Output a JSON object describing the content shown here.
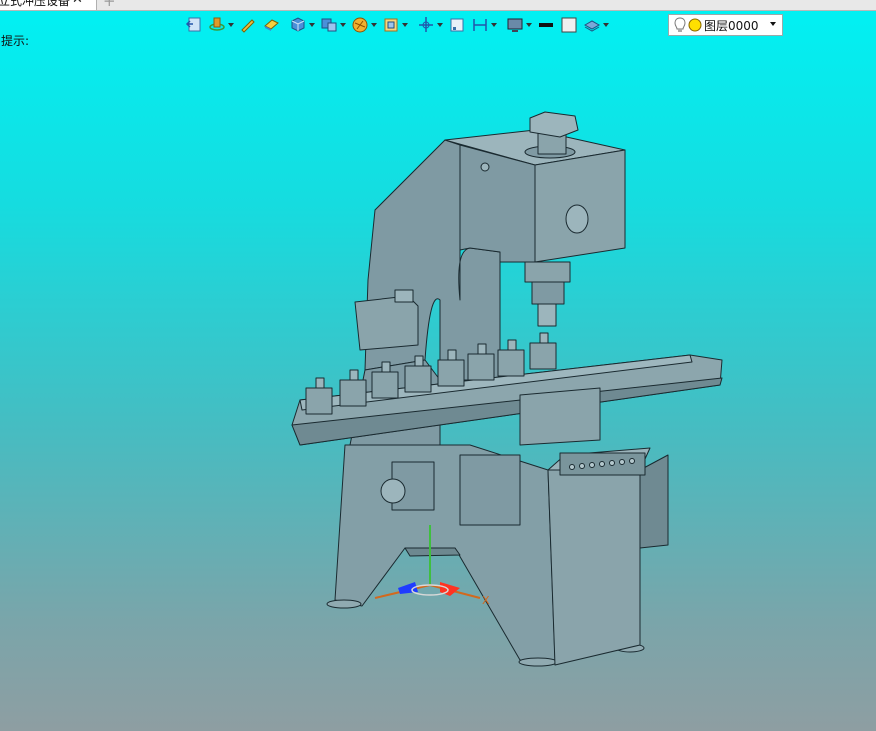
{
  "tab": {
    "title": "立式冲压设备",
    "close_glyph": "✕",
    "add_glyph": "+"
  },
  "hint": "提示:",
  "layer": {
    "value": "图层0000"
  },
  "colors": {
    "bg_top": "#00f2f4",
    "bg_bottom": "#8e9ea2",
    "model": "#7f9aa3",
    "edge": "#1a2a30"
  },
  "axis": {
    "x_label": "X"
  },
  "toolbar": [
    {
      "name": "back-view-icon",
      "dropdown": false
    },
    {
      "name": "orbit-icon",
      "dropdown": true
    },
    {
      "name": "pencil-icon",
      "dropdown": false
    },
    {
      "name": "eraser-icon",
      "dropdown": false
    },
    {
      "name": "cube-icon",
      "dropdown": true
    },
    {
      "name": "view-layout-icon",
      "dropdown": true
    },
    {
      "name": "render-style-icon",
      "dropdown": true
    },
    {
      "name": "frame-icon",
      "dropdown": true
    },
    {
      "name": "move-axis-icon",
      "dropdown": true
    },
    {
      "name": "small-square-icon",
      "dropdown": false
    },
    {
      "name": "dimension-icon",
      "dropdown": true
    },
    {
      "name": "monitor-icon",
      "dropdown": true
    },
    {
      "name": "line-color-icon",
      "dropdown": false
    },
    {
      "name": "fill-color-icon",
      "dropdown": false
    },
    {
      "name": "layer-stack-icon",
      "dropdown": true
    }
  ]
}
